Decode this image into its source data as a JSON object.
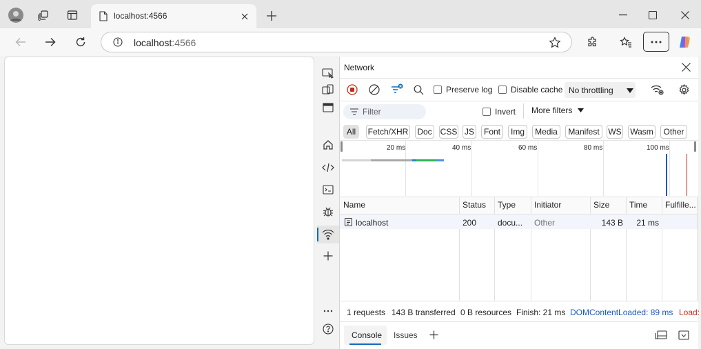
{
  "browser": {
    "tab_title": "localhost:4566",
    "address_host": "localhost",
    "address_port": ":4566"
  },
  "devtools": {
    "panel_title": "Network",
    "toolbar": {
      "preserve_log": "Preserve log",
      "disable_cache": "Disable cache",
      "throttling": "No throttling"
    },
    "filter_bar": {
      "filter_placeholder": "Filter",
      "invert": "Invert",
      "more_filters": "More filters"
    },
    "type_filters": [
      "All",
      "Fetch/XHR",
      "Doc",
      "CSS",
      "JS",
      "Font",
      "Img",
      "Media",
      "Manifest",
      "WS",
      "Wasm",
      "Other"
    ],
    "timeline_ticks": [
      "20 ms",
      "40 ms",
      "60 ms",
      "80 ms",
      "100 ms"
    ],
    "table": {
      "columns": [
        "Name",
        "Status",
        "Type",
        "Initiator",
        "Size",
        "Time",
        "Fulfille..."
      ],
      "rows": [
        {
          "name": "localhost",
          "status": "200",
          "type": "docu...",
          "initiator": "Other",
          "size": "143 B",
          "time": "21 ms",
          "fulfilled": ""
        }
      ]
    },
    "summary": {
      "requests": "1 requests",
      "transferred": "143 B transferred",
      "resources": "0 B resources",
      "finish": "Finish: 21 ms",
      "dom_content_loaded": "DOMContentLoaded: 89 ms",
      "load": "Load:"
    },
    "drawer_tabs": [
      "Console",
      "Issues"
    ],
    "colors": {
      "dcl_blue": "#1a56c4",
      "load_red": "#c42b1c",
      "accent": "#0f6cbd"
    }
  }
}
